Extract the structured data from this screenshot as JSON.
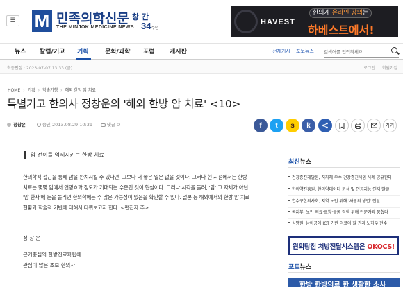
{
  "header": {
    "menu_icon": "hamburger-icon",
    "logo_mark": "M",
    "logo_title": "민족의학신문",
    "anniversary_label": "창 간",
    "anniversary_number": "34",
    "anniversary_unit": "주년",
    "logo_subtitle": "THE MINJOK MEDICINE NEWS"
  },
  "banner": {
    "brand": "HAVEST",
    "tag_prefix": "한의계 ",
    "tag_highlight": "온라인 강의",
    "tag_suffix": "는",
    "headline": "하베스트에서!"
  },
  "nav": {
    "items": [
      {
        "label": "뉴스",
        "active": false
      },
      {
        "label": "칼럼/기고",
        "active": false
      },
      {
        "label": "기획",
        "active": true
      },
      {
        "label": "문화/과학",
        "active": false
      },
      {
        "label": "포럼",
        "active": false
      },
      {
        "label": "게시판",
        "active": false
      }
    ],
    "sub_links": [
      "전체기사",
      "포토뉴스"
    ],
    "search_placeholder": "검색어를 입력하세요"
  },
  "editbar": {
    "label": "최종편집 : 2023-07-07 13:33 (금)",
    "right_links": [
      "로그인",
      "회원가입"
    ]
  },
  "breadcrumb": [
    "HOME",
    "기획",
    "학술기행",
    "해외 한방 암 치료"
  ],
  "article": {
    "title": "특별기고 한의사 정창운의 '해외 한방 암 치료' <10>",
    "author": "정창운",
    "date": "승인 2013.08.29 10:31",
    "comments": "댓글 0",
    "summary": "암 전이를 억제시키는 한방 치료",
    "lead_lines": [
      "한의학적 접근을 통해 암을 완치시킬 수 있다면, 그보다 더 좋은 일은 없을 것이다. 그러나 현 시점에서는 한방",
      "치료는 몇몇 암에서 연명효과 정도가 기대되는 수준인 것이 현실이다. 그러나 시각을 돌려, '암' 그 자체가 아닌",
      "'암 환자'에 눈을 돌리면 한의학에는 수 많은 가능성이 있음을 확인할 수 있다. 일본 등 해외에서의 한방 암 치료",
      "현황과 학술적 기반에 대해서 다뤄보고자 한다.    <편집자 주>"
    ],
    "byline": "정 창 운",
    "body_lines": [
      "근거중심의 한방진료확립에",
      "관심이 많은 초보 한의사"
    ]
  },
  "share": {
    "facebook": "f",
    "twitter": "t",
    "kakaostory": "s",
    "kakaotalk": "k",
    "share_label": "공유"
  },
  "tools": [
    "책갈피",
    "인쇄",
    "메일",
    "가가"
  ],
  "sidebar": {
    "latest_title_accent": "최신",
    "latest_title_rest": "뉴스",
    "latest_news": [
      "건강증진개발원, 지자체 우수 건강증진사업 사례 공유한다",
      "한의약진흥원, 한의약데이터 분석 및 인공지능 인재 발굴 ···",
      "연수구한의사회, 지역 노인 위해 '사랑의 냉면' 전달",
      "복지부, 노인 의료·요양·돌봄 정책 위해 전문가와 뭉쳤다",
      "심평원, 남아공에 ICT 기반 의료의 질 관리 노하우 전수"
    ],
    "ad_prefix": "원외탕전 처방전달시스템은 ",
    "ad_highlight": "OKOCS!",
    "photo_title_accent": "포토",
    "photo_title_rest": "뉴스",
    "photo_caption": "한방 한방의료 한 생활한 소사"
  },
  "colors": {
    "brand_blue": "#1a50a8",
    "facebook": "#3b5998",
    "twitter": "#1da1f2",
    "kakaostory": "#ffcd00",
    "kakaotalk": "#3a5ea8",
    "share": "#2f5fb3"
  }
}
